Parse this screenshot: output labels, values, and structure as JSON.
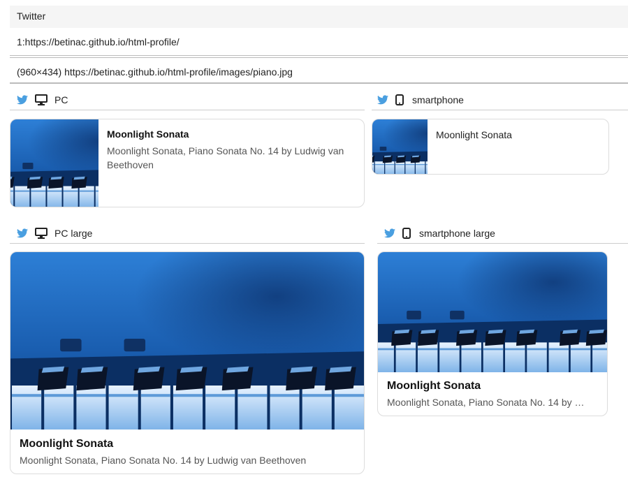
{
  "header": {
    "title": "Twitter"
  },
  "urls": {
    "page": "1:https://betinac.github.io/html-profile/",
    "image": "(960×434) https://betinac.github.io/html-profile/images/piano.jpg"
  },
  "sections": {
    "pc": {
      "label": "PC",
      "icons": [
        "twitter-bird-icon",
        "desktop-icon"
      ]
    },
    "smartphone": {
      "label": "smartphone",
      "icons": [
        "twitter-bird-icon",
        "smartphone-icon"
      ]
    },
    "pc_large": {
      "label": "PC large",
      "icons": [
        "twitter-bird-icon",
        "desktop-icon"
      ]
    },
    "smartphone_large": {
      "label": "smartphone large",
      "icons": [
        "twitter-bird-icon",
        "smartphone-icon"
      ]
    }
  },
  "card": {
    "title": "Moonlight Sonata",
    "description": "Moonlight Sonata, Piano Sonata No. 14 by Ludwig van Beethoven"
  },
  "colors": {
    "twitter_blue": "#4a9fe0",
    "piano_blue": "#1f6fc2",
    "header_bg": "#f5f5f5"
  }
}
